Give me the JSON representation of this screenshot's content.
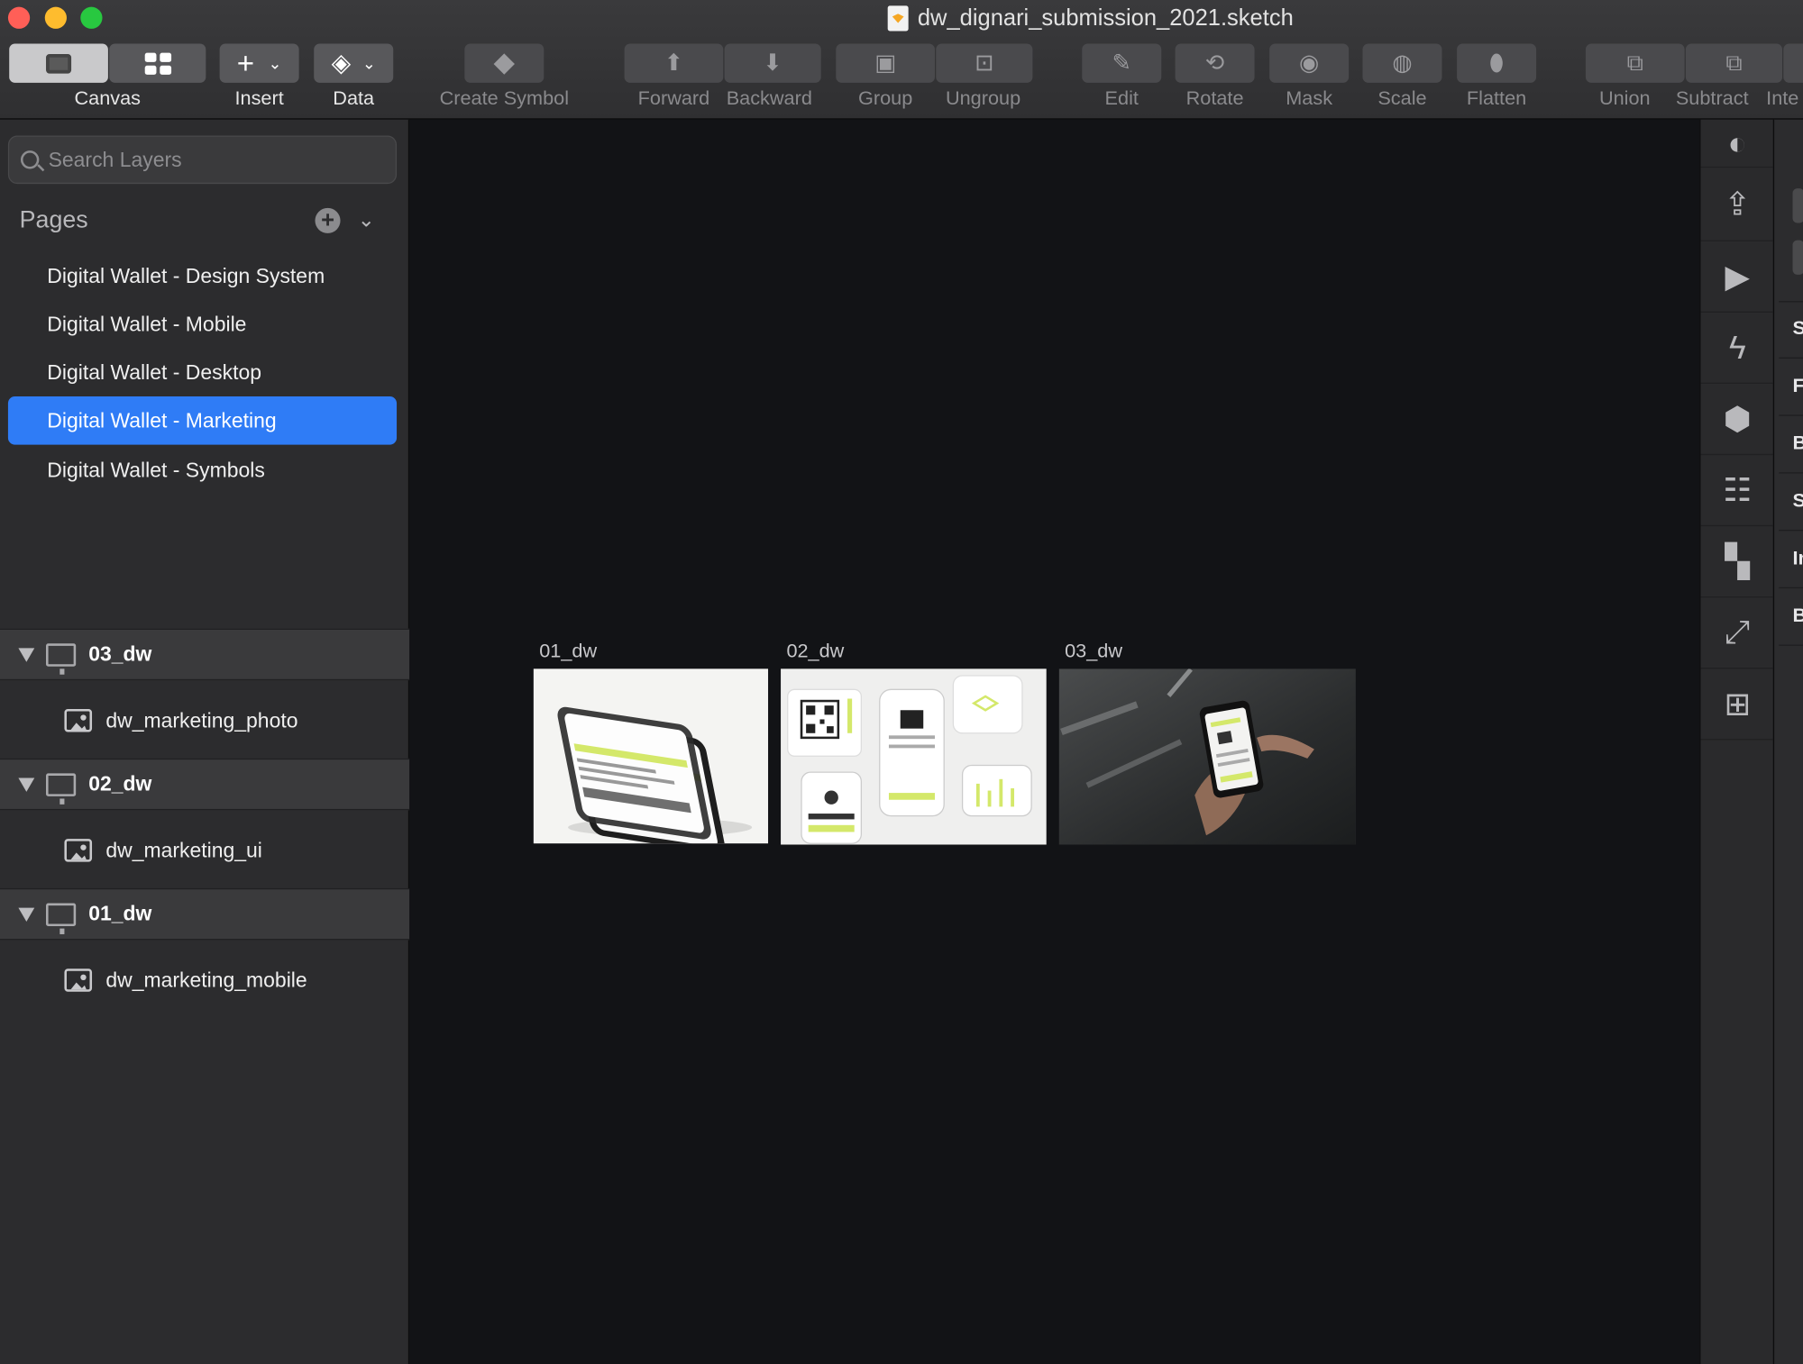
{
  "window": {
    "title": "dw_dignari_submission_2021.sketch"
  },
  "toolbar": {
    "canvas": "Canvas",
    "insert": "Insert",
    "data": "Data",
    "create_symbol": "Create Symbol",
    "forward": "Forward",
    "backward": "Backward",
    "group": "Group",
    "ungroup": "Ungroup",
    "edit": "Edit",
    "rotate": "Rotate",
    "mask": "Mask",
    "scale": "Scale",
    "flatten": "Flatten",
    "union": "Union",
    "subtract": "Subtract",
    "intersect": "Inte"
  },
  "sidebar": {
    "search_placeholder": "Search Layers",
    "pages_header": "Pages",
    "pages": [
      {
        "label": "Digital Wallet - Design System",
        "selected": false
      },
      {
        "label": "Digital Wallet - Mobile",
        "selected": false
      },
      {
        "label": "Digital Wallet - Desktop",
        "selected": false
      },
      {
        "label": "Digital Wallet - Marketing",
        "selected": true
      },
      {
        "label": "Digital Wallet - Symbols",
        "selected": false
      }
    ],
    "layers": [
      {
        "group": "03_dw",
        "child": "dw_marketing_photo"
      },
      {
        "group": "02_dw",
        "child": "dw_marketing_ui"
      },
      {
        "group": "01_dw",
        "child": "dw_marketing_mobile"
      }
    ]
  },
  "canvas": {
    "artboards": [
      {
        "title": "01_dw"
      },
      {
        "title": "02_dw"
      },
      {
        "title": "03_dw"
      }
    ]
  },
  "inspector": {
    "labels": [
      "S",
      "F",
      "B",
      "S",
      "In",
      "B"
    ]
  },
  "colors": {
    "accent": "#2f7cf6",
    "brand_lime": "#d4e86a"
  }
}
